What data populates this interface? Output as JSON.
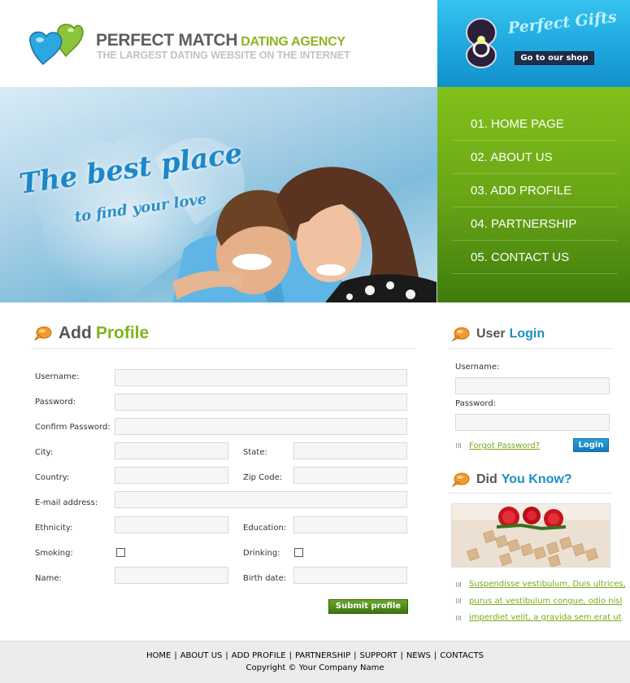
{
  "header": {
    "brand": "PERFECT MATCH",
    "brand_accent": "DATING AGENCY",
    "tagline": "THE LARGEST DATING WEBSITE ON THE INTERNET"
  },
  "gifts": {
    "title": "Perfect Gifts",
    "button": "Go to our shop"
  },
  "hero": {
    "line1": "The best place",
    "line2": "to find your love"
  },
  "nav": {
    "items": [
      {
        "label": "01. HOME PAGE"
      },
      {
        "label": "02. ABOUT US"
      },
      {
        "label": "03. ADD PROFILE"
      },
      {
        "label": "04. PARTNERSHIP"
      },
      {
        "label": "05. CONTACT US"
      }
    ]
  },
  "add_profile": {
    "title_part1": "Add",
    "title_part2": "Profile",
    "labels": {
      "username": "Username:",
      "password": "Password:",
      "confirm": "Confirm Password:",
      "city": "City:",
      "state": "State:",
      "country": "Country:",
      "zip": "Zip Code:",
      "email": "E-mail address:",
      "ethnicity": "Ethnicity:",
      "education": "Education:",
      "smoking": "Smoking:",
      "drinking": "Drinking:",
      "name": "Name:",
      "birth": "Birth date:"
    },
    "submit": "Submit profile"
  },
  "login": {
    "title_part1": "User",
    "title_part2": "Login",
    "username_label": "Username:",
    "password_label": "Password:",
    "forgot": "Forgot Password?",
    "button": "Login"
  },
  "did_you_know": {
    "title_part1": "Did",
    "title_part2": "You Know?",
    "links": [
      "Suspendisse vestibulum. Duis ultrices,",
      "purus at vestibulum congue, odio nisl",
      "imperdiet velit, a gravida sem erat ut"
    ]
  },
  "footer": {
    "links": [
      "HOME",
      "ABOUT US",
      "ADD PROFILE",
      "PARTNERSHIP",
      "SUPPORT",
      "NEWS",
      "CONTACTS"
    ],
    "copyright": "Copyright © Your Company Name"
  },
  "colors": {
    "green_accent": "#7db51d",
    "blue_accent": "#1c8fc6",
    "nav_green": "#6aa616",
    "gifts_blue": "#1ea7df"
  }
}
